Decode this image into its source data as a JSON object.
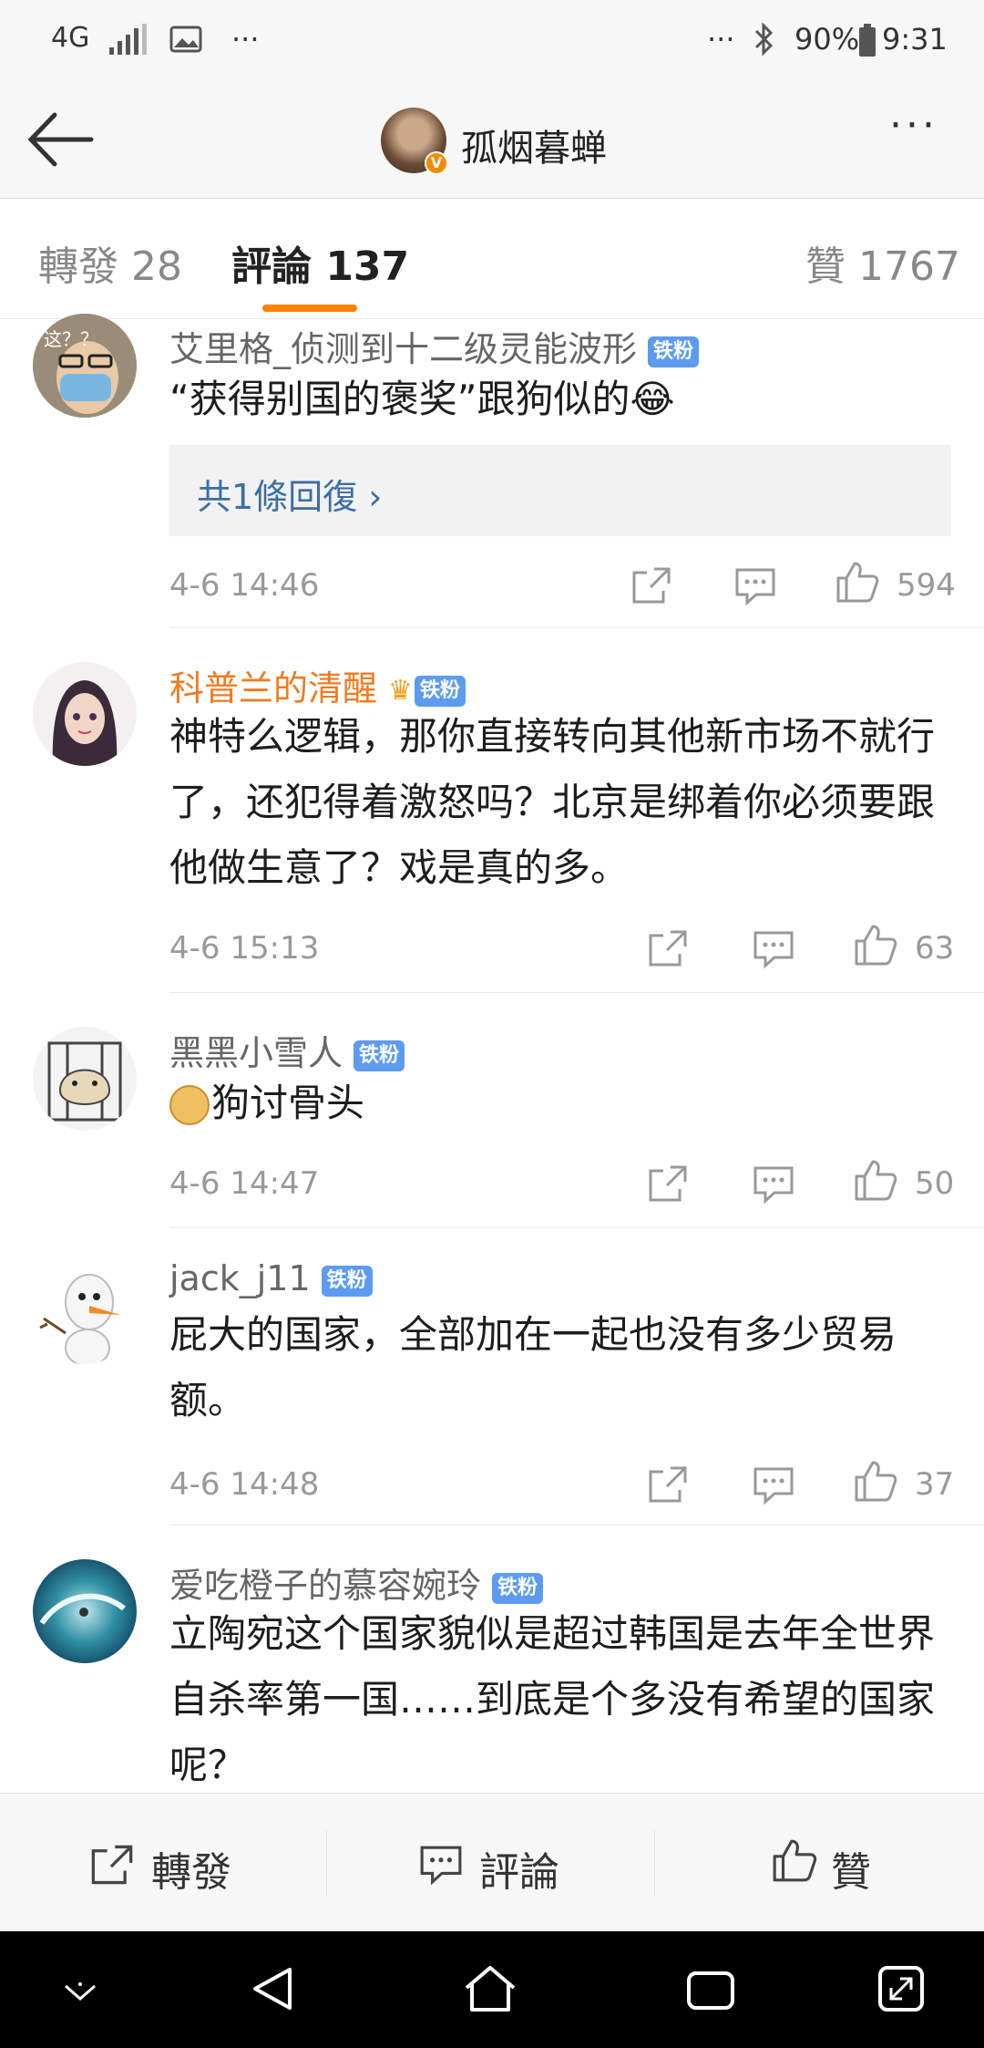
{
  "status_bar": {
    "network": "4G",
    "more": "···",
    "more2": "···",
    "battery": "90%",
    "time": "9:31"
  },
  "nav": {
    "title": "孤烟暮蝉",
    "more": "···"
  },
  "tabs": [
    {
      "label": "轉發 28"
    },
    {
      "label": "評論 137"
    },
    {
      "label": "贊 1767"
    }
  ],
  "comments": [
    {
      "username": "艾里格_侦测到十二级灵能波形",
      "badge": "铁粉",
      "avatar_text": "这？？",
      "text": "“获得别国的褒奖”跟狗似的😂",
      "reply_summary": "共1條回復 ›",
      "time": "4-6 14:46",
      "likes": "594"
    },
    {
      "username": "科普兰的清醒",
      "badge": "铁粉",
      "text": "神特么逻辑，那你直接转向其他新市场不就行了，还犯得着激怒吗？北京是绑着你必须要跟他做生意了？戏是真的多。",
      "time": "4-6 15:13",
      "likes": "63"
    },
    {
      "username": "黑黑小雪人",
      "badge": "铁粉",
      "text": "狗讨骨头",
      "time": "4-6 14:47",
      "likes": "50"
    },
    {
      "username": "jack_j11",
      "badge": "铁粉",
      "text": "屁大的国家，全部加在一起也没有多少贸易额。",
      "time": "4-6 14:48",
      "likes": "37"
    },
    {
      "username": "爱吃橙子的慕容婉玲",
      "badge": "铁粉",
      "text": "立陶宛这个国家貌似是超过韩国是去年全世界自杀率第一国……到底是个多没有希望的国家呢？"
    }
  ],
  "bottom_bar": {
    "forward": "轉發",
    "comment": "評論",
    "like": "贊"
  },
  "colors": {
    "accent": "#ff8200",
    "badge": "#5c9bf0",
    "link": "#3b6ea5",
    "vip_name": "#f07a1f"
  }
}
